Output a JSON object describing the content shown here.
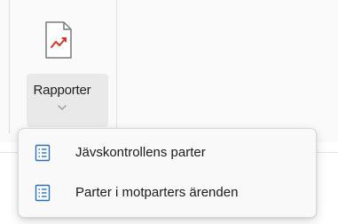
{
  "ribbon": {
    "rapporter_button": {
      "label": "Rapporter",
      "icon": "report-chart-icon",
      "dropdown_icon": "chevron-down-icon"
    }
  },
  "menu": {
    "items": [
      {
        "label": "Jävskontrollens parter",
        "icon": "list-document-icon"
      },
      {
        "label": "Parter i motparters ärenden",
        "icon": "list-document-icon"
      }
    ]
  },
  "colors": {
    "accent_blue": "#2b6fb8",
    "chart_red": "#d9342b",
    "menu_background": "#f9f9f9",
    "ribbon_background": "#fafafa"
  }
}
